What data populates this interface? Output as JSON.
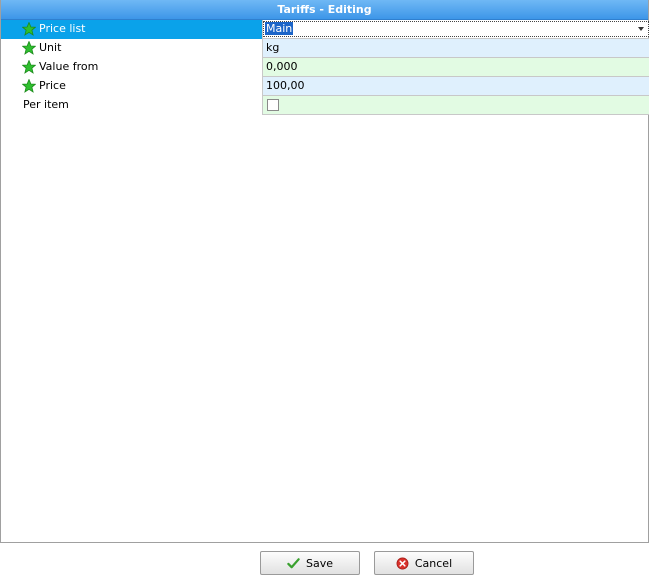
{
  "window": {
    "title": "Tariffs - Editing"
  },
  "fields": {
    "price_list": {
      "label": "Price list",
      "value": "Main"
    },
    "unit": {
      "label": "Unit",
      "value": "kg"
    },
    "value_from": {
      "label": "Value from",
      "value": "0,000"
    },
    "price": {
      "label": "Price",
      "value": "100,00"
    },
    "per_item": {
      "label": "Per item",
      "checked": false
    }
  },
  "buttons": {
    "save": "Save",
    "cancel": "Cancel"
  },
  "colors": {
    "title_bar": "#3d96e8",
    "selected_row": "#0aa2ea",
    "value_blue": "#dff0fd",
    "value_green": "#e2fbe3",
    "required_star": "#2fbf2f"
  },
  "icons": {
    "required": "star-icon",
    "save": "checkmark-icon",
    "cancel": "cancel-icon"
  }
}
